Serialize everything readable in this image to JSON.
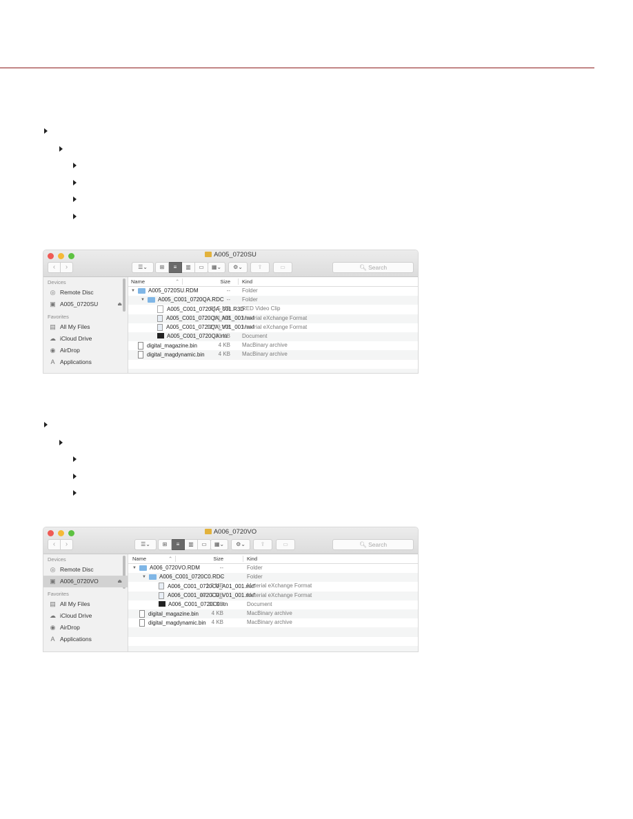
{
  "page": {
    "accent_rule_color": "#8b1a1a",
    "bullet_groups": [
      {
        "levels": [
          1,
          2,
          3,
          3,
          3,
          3
        ]
      },
      {
        "levels": [
          1,
          2,
          3,
          3,
          3
        ]
      }
    ]
  },
  "windows": [
    {
      "title": "A005_0720SU",
      "search_placeholder": "Search",
      "sidebar": {
        "devices_label": "Devices",
        "devices": [
          {
            "label": "Remote Disc",
            "icon": "disc-icon",
            "selected": false
          },
          {
            "label": "A005_0720SU",
            "icon": "drive-icon",
            "selected": false,
            "eject": "⏏"
          }
        ],
        "favorites_label": "Favorites",
        "favorites": [
          {
            "label": "All My Files",
            "icon": "all-files-icon"
          },
          {
            "label": "iCloud Drive",
            "icon": "cloud-icon"
          },
          {
            "label": "AirDrop",
            "icon": "airdrop-icon"
          },
          {
            "label": "Applications",
            "icon": "applications-icon"
          }
        ]
      },
      "columns": {
        "name": "Name",
        "size": "Size",
        "kind": "Kind"
      },
      "rows": [
        {
          "name": "A005_0720SU.RDM",
          "size": "--",
          "kind": "Folder",
          "indent": 0,
          "type": "folder",
          "disclosure": "▼"
        },
        {
          "name": "A005_C001_0720QA.RDC",
          "size": "--",
          "kind": "Folder",
          "indent": 1,
          "type": "folder",
          "disclosure": "▼"
        },
        {
          "name": "A005_C001_0720QA_001.R3D",
          "size": "64.5 MB",
          "kind": "RED Video Clip",
          "indent": 2,
          "type": "doc"
        },
        {
          "name": "A005_C001_0720QA_A01_001.mxf",
          "size": "2.1 MB",
          "kind": "Material eXchange Format",
          "indent": 2,
          "type": "mxf"
        },
        {
          "name": "A005_C001_0720QA_V01_001.mxf",
          "size": "127.3 MB",
          "kind": "Material eXchange Format",
          "indent": 2,
          "type": "mxf"
        },
        {
          "name": "A005_C001_0720QA.rtn",
          "size": "33 KB",
          "kind": "Document",
          "indent": 2,
          "type": "rtn"
        },
        {
          "name": "digital_magazine.bin",
          "size": "4 KB",
          "kind": "MacBinary archive",
          "indent": -1,
          "type": "bin"
        },
        {
          "name": "digital_magdynamic.bin",
          "size": "4 KB",
          "kind": "MacBinary archive",
          "indent": -1,
          "type": "bin"
        }
      ]
    },
    {
      "title": "A006_0720VO",
      "search_placeholder": "Search",
      "sidebar": {
        "devices_label": "Devices",
        "devices": [
          {
            "label": "Remote Disc",
            "icon": "disc-icon",
            "selected": false
          },
          {
            "label": "A006_0720VO",
            "icon": "drive-icon",
            "selected": true,
            "eject": "⏏"
          }
        ],
        "favorites_label": "Favorites",
        "favorites": [
          {
            "label": "All My Files",
            "icon": "all-files-icon"
          },
          {
            "label": "iCloud Drive",
            "icon": "cloud-icon"
          },
          {
            "label": "AirDrop",
            "icon": "airdrop-icon"
          },
          {
            "label": "Applications",
            "icon": "applications-icon"
          }
        ]
      },
      "columns": {
        "name": "Name",
        "size": "Size",
        "kind": "Kind"
      },
      "rows": [
        {
          "name": "A006_0720VO.RDM",
          "size": "--",
          "kind": "Folder",
          "indent": 0,
          "type": "folder",
          "disclosure": "▼"
        },
        {
          "name": "A006_C001_0720C0.RDC",
          "size": "--",
          "kind": "Folder",
          "indent": 1,
          "type": "folder",
          "disclosure": "▼"
        },
        {
          "name": "A006_C001_0720C0_A01_001.mxf",
          "size": "1.8 MB",
          "kind": "Material eXchange Format",
          "indent": 2,
          "type": "mxf"
        },
        {
          "name": "A006_C001_0720C0_V01_001.mxf",
          "size": "107.7 MB",
          "kind": "Material eXchange Format",
          "indent": 2,
          "type": "mxf"
        },
        {
          "name": "A006_C001_0720C0.rtn",
          "size": "33 KB",
          "kind": "Document",
          "indent": 2,
          "type": "rtn"
        },
        {
          "name": "digital_magazine.bin",
          "size": "4 KB",
          "kind": "MacBinary archive",
          "indent": -1,
          "type": "bin"
        },
        {
          "name": "digital_magdynamic.bin",
          "size": "4 KB",
          "kind": "MacBinary archive",
          "indent": -1,
          "type": "bin"
        }
      ]
    }
  ]
}
